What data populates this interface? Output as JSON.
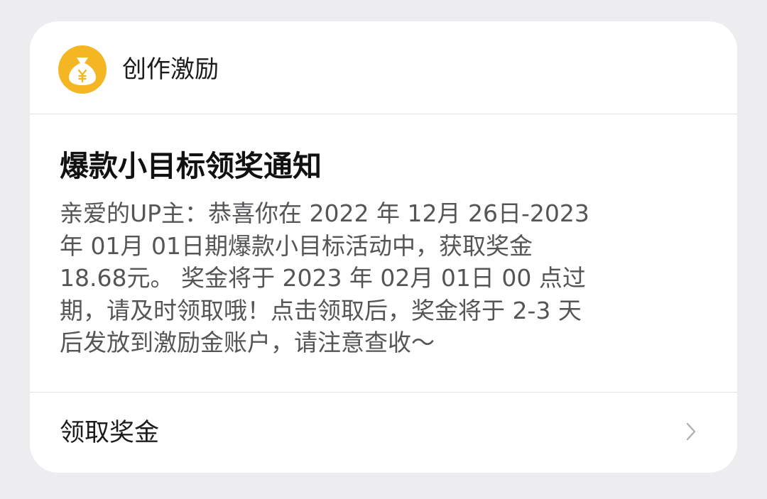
{
  "header": {
    "app_name": "创作激励",
    "icon": "money-bag-icon",
    "icon_color": "#f5b623"
  },
  "message": {
    "title": "爆款小目标领奖通知",
    "body_lines": [
      "亲爱的UP主：恭喜你在 2022 年 12月 26日-2023",
      "年 01月 01日期爆款小目标活动中，获取奖金",
      "18.68元。 奖金将于 2023 年 02月 01日 00 点过",
      "期，请及时领取哦！点击领取后，奖金将于 2-3 天",
      "后发放到激励金账户，请注意查收～"
    ]
  },
  "footer": {
    "action_label": "领取奖金",
    "chevron_icon": "chevron-right-icon"
  }
}
